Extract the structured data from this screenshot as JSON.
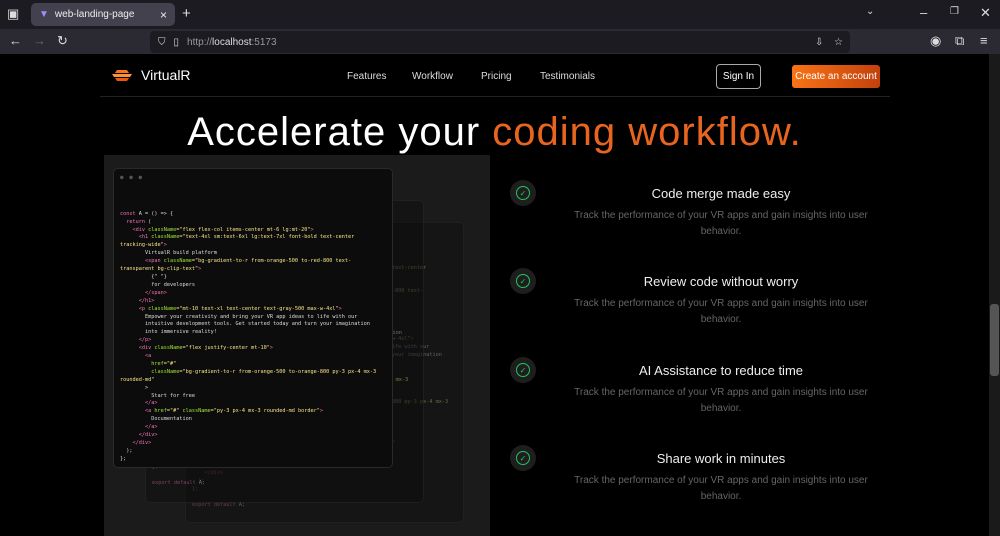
{
  "browser": {
    "tab_title": "web-landing-page",
    "url_prefix": "http://",
    "url_host": "localhost",
    "url_port": ":5173"
  },
  "header": {
    "brand": "VirtualR",
    "nav": [
      "Features",
      "Workflow",
      "Pricing",
      "Testimonials"
    ],
    "sign_in": "Sign In",
    "create_account": "Create an account"
  },
  "hero": {
    "title_plain": "Accelerate your ",
    "title_accent": "coding workflow."
  },
  "code_dots": "● ● ●",
  "code": [
    [
      [
        "k",
        "const"
      ],
      [
        "t",
        " A = () => {"
      ]
    ],
    [
      [
        "k",
        "  return"
      ],
      [
        "t",
        " ("
      ]
    ],
    [
      [
        "k",
        "    <div "
      ],
      [
        "a",
        "className"
      ],
      [
        "s",
        "=\"flex flex-col items-center mt-6 lg:mt-20\""
      ],
      [
        "k",
        ">"
      ]
    ],
    [
      [
        "k",
        "      <h1 "
      ],
      [
        "a",
        "className"
      ],
      [
        "s",
        "=\"text-4xl sm:text-6xl lg:text-7xl font-bold text-center"
      ]
    ],
    [
      [
        "s",
        "tracking-wide\""
      ],
      [
        "k",
        ">"
      ]
    ],
    [
      [
        "t",
        "        VirtualR build platform"
      ]
    ],
    [
      [
        "k",
        "        <span "
      ],
      [
        "a",
        "className"
      ],
      [
        "s",
        "=\"bg-gradient-to-r from-orange-500 to-red-800 text-"
      ]
    ],
    [
      [
        "s",
        "transparent bg-clip-text\""
      ],
      [
        "k",
        ">"
      ]
    ],
    [
      [
        "t",
        "          {\" \"}"
      ]
    ],
    [
      [
        "t",
        "          for developers"
      ]
    ],
    [
      [
        "k",
        "        </span>"
      ]
    ],
    [
      [
        "k",
        "      </h1>"
      ]
    ],
    [
      [
        "k",
        "      <p "
      ],
      [
        "a",
        "className"
      ],
      [
        "s",
        "=\"mt-10 text-xl text-center text-gray-500 max-w-4xl\""
      ],
      [
        "k",
        ">"
      ]
    ],
    [
      [
        "t",
        "        Empower your creativity and bring your VR app ideas to life with our"
      ]
    ],
    [
      [
        "t",
        "        intuitive development tools. Get started today and turn your imagination"
      ]
    ],
    [
      [
        "t",
        "        into immersive reality!"
      ]
    ],
    [
      [
        "k",
        "      </p>"
      ]
    ],
    [
      [
        "k",
        "      <div "
      ],
      [
        "a",
        "className"
      ],
      [
        "s",
        "=\"flex justify-center mt-10\""
      ],
      [
        "k",
        ">"
      ]
    ],
    [
      [
        "k",
        "        <a"
      ]
    ],
    [
      [
        "a",
        "          href"
      ],
      [
        "s",
        "=\"#\""
      ]
    ],
    [
      [
        "a",
        "          className"
      ],
      [
        "s",
        "=\"bg-gradient-to-r from-orange-500 to-orange-800 py-3 px-4 mx-3"
      ]
    ],
    [
      [
        "s",
        "rounded-md\""
      ]
    ],
    [
      [
        "t",
        "        >"
      ]
    ],
    [
      [
        "t",
        "          Start for free"
      ]
    ],
    [
      [
        "k",
        "        </a>"
      ]
    ],
    [
      [
        "k",
        "        <a "
      ],
      [
        "a",
        "href"
      ],
      [
        "s",
        "=\"#\" "
      ],
      [
        "a",
        "className"
      ],
      [
        "s",
        "=\"py-3 px-4 mx-3 rounded-md border\""
      ],
      [
        "k",
        ">"
      ]
    ],
    [
      [
        "t",
        "          Documentation"
      ]
    ],
    [
      [
        "k",
        "        </a>"
      ]
    ],
    [
      [
        "k",
        "      </div>"
      ]
    ],
    [
      [
        "k",
        "    </div>"
      ]
    ],
    [
      [
        "t",
        "  );"
      ]
    ],
    [
      [
        "t",
        "};"
      ]
    ],
    [
      [
        "t",
        ""
      ]
    ],
    [
      [
        "k",
        "export default"
      ],
      [
        "t",
        " A;"
      ]
    ]
  ],
  "features": [
    {
      "title": "Code merge made easy",
      "desc": "Track the performance of your VR apps and gain insights into user behavior."
    },
    {
      "title": "Review code without worry",
      "desc": "Track the performance of your VR apps and gain insights into user behavior."
    },
    {
      "title": "AI Assistance to reduce time",
      "desc": "Track the performance of your VR apps and gain insights into user behavior."
    },
    {
      "title": "Share work in minutes",
      "desc": "Track the performance of your VR apps and gain insights into user behavior."
    }
  ],
  "colors": {
    "accent": "#f97316",
    "check": "#22c55e"
  }
}
